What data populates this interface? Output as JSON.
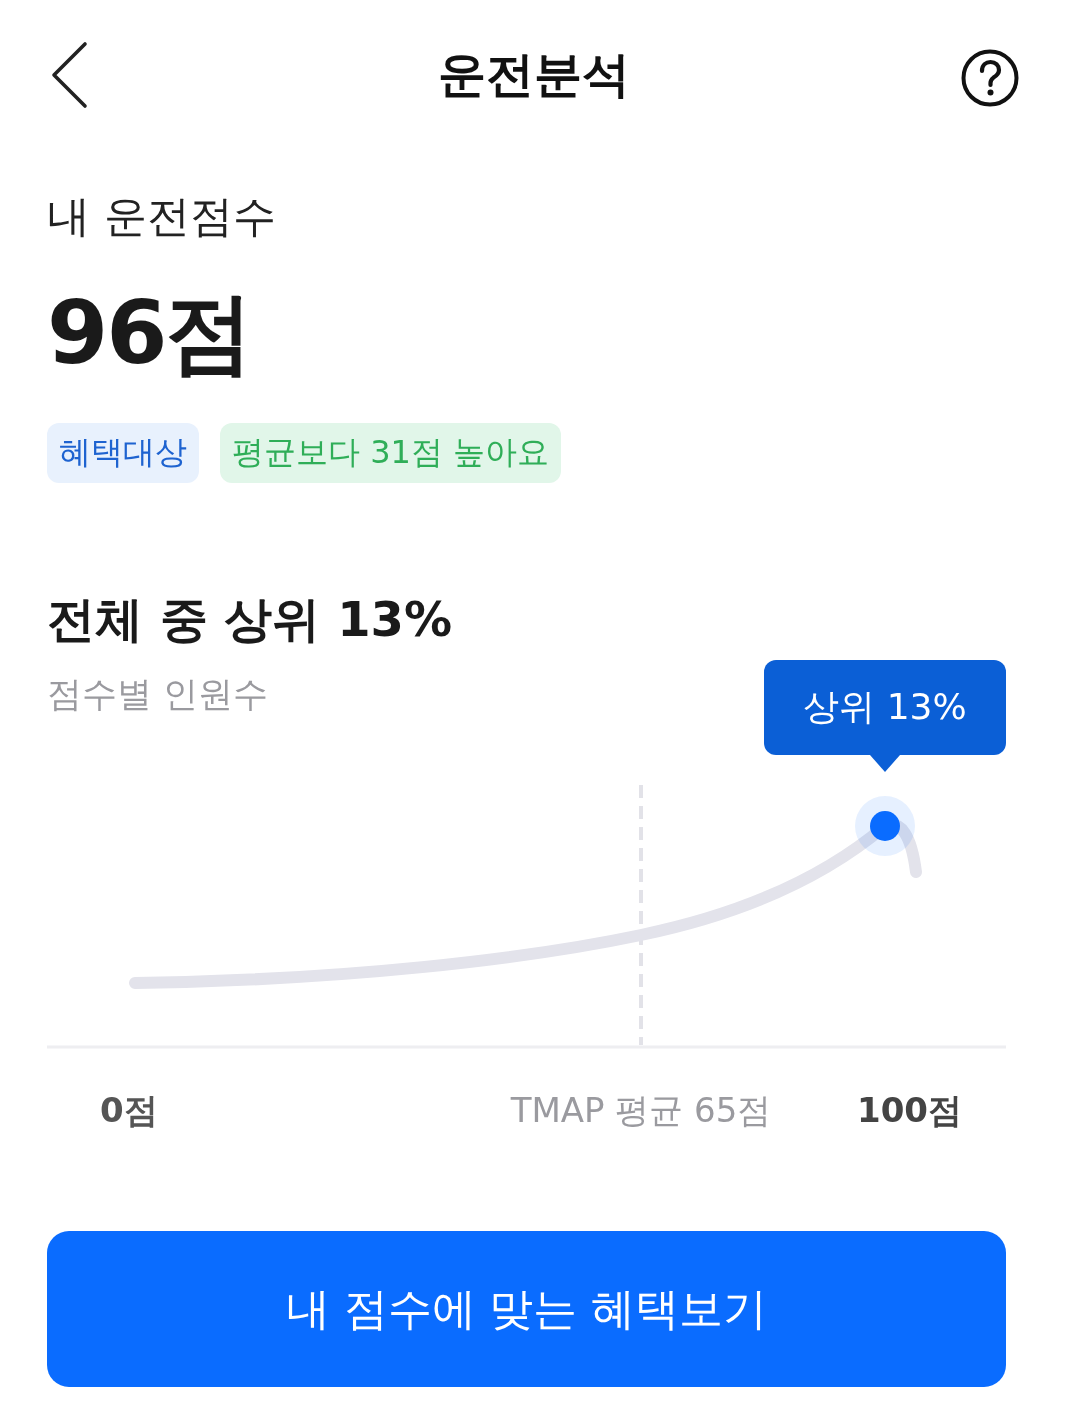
{
  "header": {
    "title": "운전분석"
  },
  "score": {
    "label": "내 운전점수",
    "value": "96점",
    "badges": [
      {
        "text": "혜택대상",
        "kind": "benefit"
      },
      {
        "text": "평균보다 31점 높아요",
        "kind": "comparison"
      }
    ]
  },
  "ranking": {
    "title": "전체 중 상위 13%",
    "subtitle": "점수별 인원수",
    "tooltip": "상위 13%",
    "axis_labels": [
      {
        "text": "0점",
        "kind": "min"
      },
      {
        "text": "TMAP 평균 65점",
        "kind": "average"
      },
      {
        "text": "100점",
        "kind": "max"
      }
    ]
  },
  "cta_button": {
    "label": "내 점수에 맞는 혜택보기"
  }
}
